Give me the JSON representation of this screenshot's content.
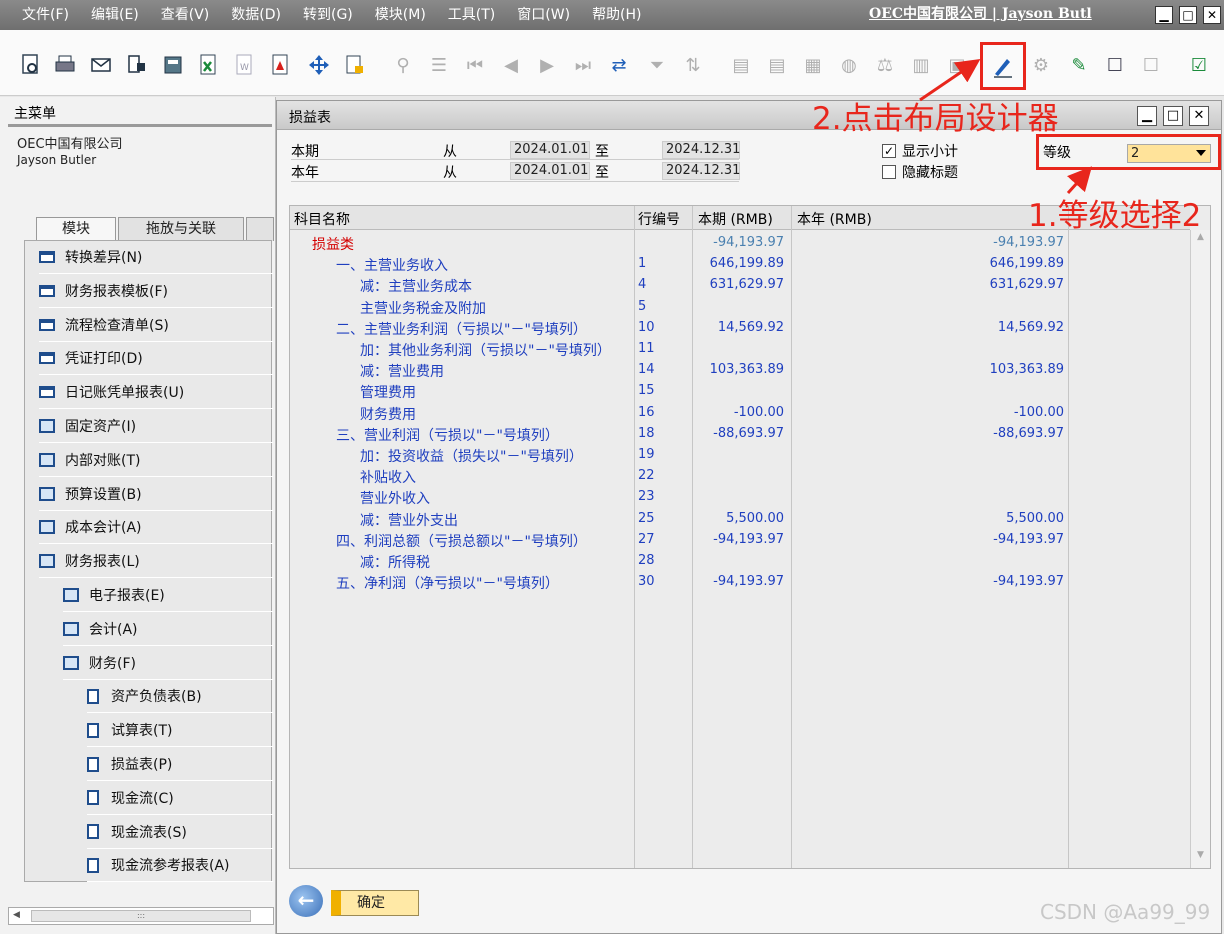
{
  "menubar": {
    "items": [
      "文件(F)",
      "编辑(E)",
      "查看(V)",
      "数据(D)",
      "转到(G)",
      "模块(M)",
      "工具(T)",
      "窗口(W)",
      "帮助(H)"
    ],
    "company_user": "OEC中国有限公司 | Jayson Butl"
  },
  "left_pane": {
    "title": "主菜单",
    "company": "OEC中国有限公司",
    "user": "Jayson Butler",
    "tabs": [
      "模块",
      "拖放与关联"
    ],
    "items": [
      {
        "label": "转换差异(N)",
        "type": "module",
        "indent": 0
      },
      {
        "label": "财务报表模板(F)",
        "type": "module",
        "indent": 0
      },
      {
        "label": "流程检查清单(S)",
        "type": "module",
        "indent": 0
      },
      {
        "label": "凭证打印(D)",
        "type": "module",
        "indent": 0
      },
      {
        "label": "日记账凭单报表(U)",
        "type": "module",
        "indent": 0
      },
      {
        "label": "固定资产(I)",
        "type": "folder",
        "indent": 0
      },
      {
        "label": "内部对账(T)",
        "type": "folder",
        "indent": 0
      },
      {
        "label": "预算设置(B)",
        "type": "folder",
        "indent": 0
      },
      {
        "label": "成本会计(A)",
        "type": "folder",
        "indent": 0
      },
      {
        "label": "财务报表(L)",
        "type": "folder-open",
        "indent": 0
      },
      {
        "label": "电子报表(E)",
        "type": "folder",
        "indent": 1
      },
      {
        "label": "会计(A)",
        "type": "folder",
        "indent": 1
      },
      {
        "label": "财务(F)",
        "type": "folder-open",
        "indent": 1
      },
      {
        "label": "资产负债表(B)",
        "type": "doc",
        "indent": 2
      },
      {
        "label": "试算表(T)",
        "type": "doc",
        "indent": 2
      },
      {
        "label": "损益表(P)",
        "type": "doc",
        "indent": 2
      },
      {
        "label": "现金流(C)",
        "type": "doc",
        "indent": 2
      },
      {
        "label": "现金流表(S)",
        "type": "doc",
        "indent": 2
      },
      {
        "label": "现金流参考报表(A)",
        "type": "doc",
        "indent": 2
      }
    ]
  },
  "report": {
    "title": "损益表",
    "criteria": {
      "period_label": "本期",
      "year_label": "本年",
      "from_label": "从",
      "to_label": "至",
      "period_from": "2024.01.01",
      "period_to": "2024.12.31",
      "year_from": "2024.01.01",
      "year_to": "2024.12.31",
      "show_subtotal_label": "显示小计",
      "show_subtotal_checked": true,
      "hide_title_label": "隐藏标题",
      "hide_title_checked": false,
      "level_label": "等级",
      "level_value": "2"
    },
    "columns": [
      "科目名称",
      "行编号",
      "本期 (RMB)",
      "本年 (RMB)"
    ],
    "rows": [
      {
        "name": "损益类",
        "level": 0,
        "line": "",
        "current": "-94,193.97",
        "ytd": "-94,193.97"
      },
      {
        "name": "一、主营业务收入",
        "level": 1,
        "line": "1",
        "current": "646,199.89",
        "ytd": "646,199.89"
      },
      {
        "name": "减：主营业务成本",
        "level": 2,
        "line": "4",
        "current": "631,629.97",
        "ytd": "631,629.97"
      },
      {
        "name": "主营业务税金及附加",
        "level": 2,
        "line": "5",
        "current": "",
        "ytd": ""
      },
      {
        "name": "二、主营业务利润（亏损以\"－\"号填列）",
        "level": 1,
        "line": "10",
        "current": "14,569.92",
        "ytd": "14,569.92"
      },
      {
        "name": "加：其他业务利润（亏损以\"－\"号填列）",
        "level": 2,
        "line": "11",
        "current": "",
        "ytd": ""
      },
      {
        "name": "减：营业费用",
        "level": 2,
        "line": "14",
        "current": "103,363.89",
        "ytd": "103,363.89"
      },
      {
        "name": "管理费用",
        "level": 2,
        "line": "15",
        "current": "",
        "ytd": ""
      },
      {
        "name": "财务费用",
        "level": 2,
        "line": "16",
        "current": "-100.00",
        "ytd": "-100.00"
      },
      {
        "name": "三、营业利润（亏损以\"－\"号填列）",
        "level": 1,
        "line": "18",
        "current": "-88,693.97",
        "ytd": "-88,693.97"
      },
      {
        "name": "加：投资收益（损失以\"－\"号填列）",
        "level": 2,
        "line": "19",
        "current": "",
        "ytd": ""
      },
      {
        "name": "补贴收入",
        "level": 2,
        "line": "22",
        "current": "",
        "ytd": ""
      },
      {
        "name": "营业外收入",
        "level": 2,
        "line": "23",
        "current": "",
        "ytd": ""
      },
      {
        "name": "减：营业外支出",
        "level": 2,
        "line": "25",
        "current": "5,500.00",
        "ytd": "5,500.00"
      },
      {
        "name": "四、利润总额（亏损总额以\"－\"号填列）",
        "level": 1,
        "line": "27",
        "current": "-94,193.97",
        "ytd": "-94,193.97"
      },
      {
        "name": "减：所得税",
        "level": 2,
        "line": "28",
        "current": "",
        "ytd": ""
      },
      {
        "name": "五、净利润（净亏损以\"－\"号填列）",
        "level": 1,
        "line": "30",
        "current": "-94,193.97",
        "ytd": "-94,193.97"
      }
    ],
    "ok_label": "确定"
  },
  "annotations": {
    "step1": "1.等级选择2",
    "step2": "2.点击布局设计器"
  },
  "watermark": "CSDN @Aa99_99",
  "colors": {
    "annotation_red": "#e8261c",
    "category_red": "#d40000",
    "account_blue": "#1f3fbf",
    "level_field": "#ffe39a"
  }
}
